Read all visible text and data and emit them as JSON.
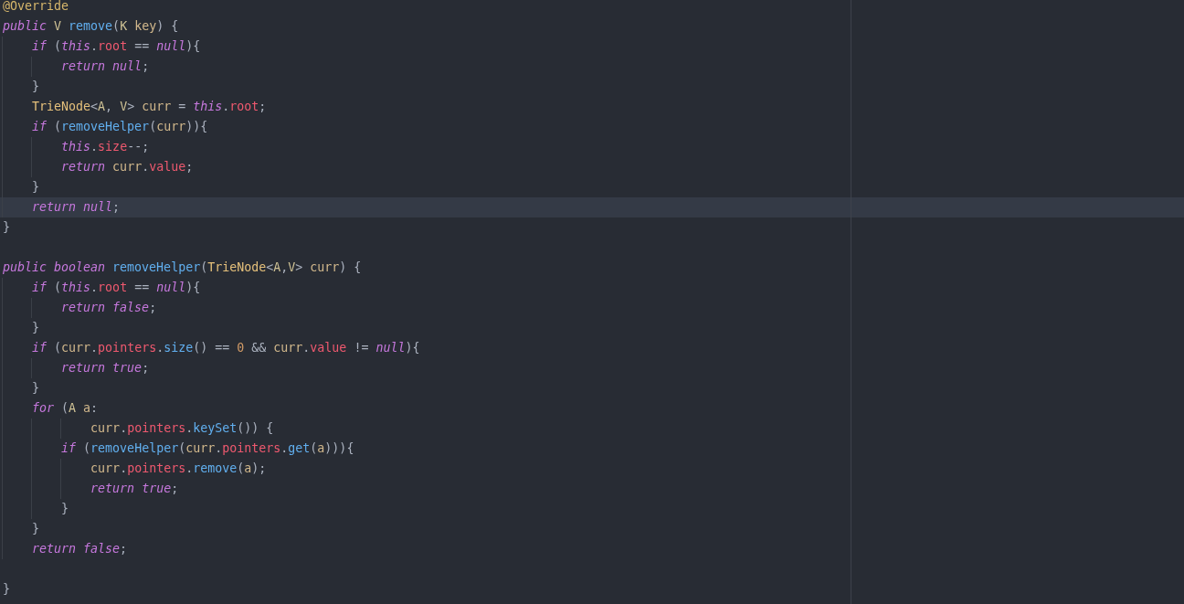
{
  "editor": {
    "lines": [
      {
        "current": false,
        "tokens": [
          {
            "kind": "ann",
            "text": "@Override"
          }
        ]
      },
      {
        "current": false,
        "tokens": [
          {
            "kind": "kw",
            "text": "public"
          },
          {
            "kind": "tparam",
            "text": " V"
          },
          {
            "kind": "fn",
            "text": " remove"
          },
          {
            "kind": "punct",
            "text": "("
          },
          {
            "kind": "tparam",
            "text": "K"
          },
          {
            "kind": "var",
            "text": " key"
          },
          {
            "kind": "punct",
            "text": ") {"
          }
        ]
      },
      {
        "current": false,
        "tokens": [
          {
            "kind": "kw",
            "text": "    if"
          },
          {
            "kind": "punct",
            "text": " ("
          },
          {
            "kind": "kw",
            "text": "this"
          },
          {
            "kind": "punct",
            "text": "."
          },
          {
            "kind": "field",
            "text": "root"
          },
          {
            "kind": "punct",
            "text": " == "
          },
          {
            "kind": "kw",
            "text": "null"
          },
          {
            "kind": "punct",
            "text": "){"
          }
        ]
      },
      {
        "current": false,
        "tokens": [
          {
            "kind": "kw",
            "text": "        return null"
          },
          {
            "kind": "punct",
            "text": ";"
          }
        ]
      },
      {
        "current": false,
        "tokens": [
          {
            "kind": "punct",
            "text": "    }"
          }
        ]
      },
      {
        "current": false,
        "tokens": [
          {
            "kind": "type",
            "text": "    TrieNode"
          },
          {
            "kind": "punct",
            "text": "<"
          },
          {
            "kind": "tparam",
            "text": "A"
          },
          {
            "kind": "punct",
            "text": ", "
          },
          {
            "kind": "tparam",
            "text": "V"
          },
          {
            "kind": "punct",
            "text": ">"
          },
          {
            "kind": "var",
            "text": " curr"
          },
          {
            "kind": "punct",
            "text": " = "
          },
          {
            "kind": "kw",
            "text": "this"
          },
          {
            "kind": "punct",
            "text": "."
          },
          {
            "kind": "field",
            "text": "root"
          },
          {
            "kind": "punct",
            "text": ";"
          }
        ]
      },
      {
        "current": false,
        "tokens": [
          {
            "kind": "kw",
            "text": "    if"
          },
          {
            "kind": "punct",
            "text": " ("
          },
          {
            "kind": "fn",
            "text": "removeHelper"
          },
          {
            "kind": "punct",
            "text": "("
          },
          {
            "kind": "var",
            "text": "curr"
          },
          {
            "kind": "punct",
            "text": ")){"
          }
        ]
      },
      {
        "current": false,
        "tokens": [
          {
            "kind": "kw",
            "text": "        this"
          },
          {
            "kind": "punct",
            "text": "."
          },
          {
            "kind": "field",
            "text": "size"
          },
          {
            "kind": "punct",
            "text": "--;"
          }
        ]
      },
      {
        "current": false,
        "tokens": [
          {
            "kind": "kw",
            "text": "        return"
          },
          {
            "kind": "var",
            "text": " curr"
          },
          {
            "kind": "punct",
            "text": "."
          },
          {
            "kind": "field",
            "text": "value"
          },
          {
            "kind": "punct",
            "text": ";"
          }
        ]
      },
      {
        "current": false,
        "tokens": [
          {
            "kind": "punct",
            "text": "    }"
          }
        ]
      },
      {
        "current": true,
        "tokens": [
          {
            "kind": "kw",
            "text": "    return null"
          },
          {
            "kind": "punct",
            "text": ";"
          }
        ]
      },
      {
        "current": false,
        "tokens": [
          {
            "kind": "punct",
            "text": "}"
          }
        ]
      },
      {
        "current": false
      },
      {
        "current": false,
        "tokens": [
          {
            "kind": "kw",
            "text": "public boolean"
          },
          {
            "kind": "fn",
            "text": " removeHelper"
          },
          {
            "kind": "punct",
            "text": "("
          },
          {
            "kind": "type",
            "text": "TrieNode"
          },
          {
            "kind": "punct",
            "text": "<"
          },
          {
            "kind": "tparam",
            "text": "A"
          },
          {
            "kind": "punct",
            "text": ","
          },
          {
            "kind": "tparam",
            "text": "V"
          },
          {
            "kind": "punct",
            "text": ">"
          },
          {
            "kind": "var",
            "text": " curr"
          },
          {
            "kind": "punct",
            "text": ") {"
          }
        ]
      },
      {
        "current": false,
        "tokens": [
          {
            "kind": "kw",
            "text": "    if"
          },
          {
            "kind": "punct",
            "text": " ("
          },
          {
            "kind": "kw",
            "text": "this"
          },
          {
            "kind": "punct",
            "text": "."
          },
          {
            "kind": "field",
            "text": "root"
          },
          {
            "kind": "punct",
            "text": " == "
          },
          {
            "kind": "kw",
            "text": "null"
          },
          {
            "kind": "punct",
            "text": "){"
          }
        ]
      },
      {
        "current": false,
        "tokens": [
          {
            "kind": "kw",
            "text": "        return false"
          },
          {
            "kind": "punct",
            "text": ";"
          }
        ]
      },
      {
        "current": false,
        "tokens": [
          {
            "kind": "punct",
            "text": "    }"
          }
        ]
      },
      {
        "current": false,
        "tokens": [
          {
            "kind": "kw",
            "text": "    if"
          },
          {
            "kind": "punct",
            "text": " ("
          },
          {
            "kind": "var",
            "text": "curr"
          },
          {
            "kind": "punct",
            "text": "."
          },
          {
            "kind": "field",
            "text": "pointers"
          },
          {
            "kind": "punct",
            "text": "."
          },
          {
            "kind": "fn",
            "text": "size"
          },
          {
            "kind": "punct",
            "text": "() == "
          },
          {
            "kind": "num",
            "text": "0"
          },
          {
            "kind": "punct",
            "text": " && "
          },
          {
            "kind": "var",
            "text": "curr"
          },
          {
            "kind": "punct",
            "text": "."
          },
          {
            "kind": "field",
            "text": "value"
          },
          {
            "kind": "punct",
            "text": " != "
          },
          {
            "kind": "kw",
            "text": "null"
          },
          {
            "kind": "punct",
            "text": "){"
          }
        ]
      },
      {
        "current": false,
        "tokens": [
          {
            "kind": "kw",
            "text": "        return true"
          },
          {
            "kind": "punct",
            "text": ";"
          }
        ]
      },
      {
        "current": false,
        "tokens": [
          {
            "kind": "punct",
            "text": "    }"
          }
        ]
      },
      {
        "current": false,
        "tokens": [
          {
            "kind": "kw",
            "text": "    for"
          },
          {
            "kind": "punct",
            "text": " ("
          },
          {
            "kind": "tparam",
            "text": "A"
          },
          {
            "kind": "var",
            "text": " a"
          },
          {
            "kind": "punct",
            "text": ":"
          }
        ]
      },
      {
        "current": false,
        "tokens": [
          {
            "kind": "var",
            "text": "            curr"
          },
          {
            "kind": "punct",
            "text": "."
          },
          {
            "kind": "field",
            "text": "pointers"
          },
          {
            "kind": "punct",
            "text": "."
          },
          {
            "kind": "fn",
            "text": "keySet"
          },
          {
            "kind": "punct",
            "text": "()) {"
          }
        ]
      },
      {
        "current": false,
        "tokens": [
          {
            "kind": "kw",
            "text": "        if"
          },
          {
            "kind": "punct",
            "text": " ("
          },
          {
            "kind": "fn",
            "text": "removeHelper"
          },
          {
            "kind": "punct",
            "text": "("
          },
          {
            "kind": "var",
            "text": "curr"
          },
          {
            "kind": "punct",
            "text": "."
          },
          {
            "kind": "field",
            "text": "pointers"
          },
          {
            "kind": "punct",
            "text": "."
          },
          {
            "kind": "fn",
            "text": "get"
          },
          {
            "kind": "punct",
            "text": "("
          },
          {
            "kind": "var",
            "text": "a"
          },
          {
            "kind": "punct",
            "text": "))){"
          }
        ]
      },
      {
        "current": false,
        "tokens": [
          {
            "kind": "var",
            "text": "            curr"
          },
          {
            "kind": "punct",
            "text": "."
          },
          {
            "kind": "field",
            "text": "pointers"
          },
          {
            "kind": "punct",
            "text": "."
          },
          {
            "kind": "fn",
            "text": "remove"
          },
          {
            "kind": "punct",
            "text": "("
          },
          {
            "kind": "var",
            "text": "a"
          },
          {
            "kind": "punct",
            "text": ");"
          }
        ]
      },
      {
        "current": false,
        "tokens": [
          {
            "kind": "kw",
            "text": "            return true"
          },
          {
            "kind": "punct",
            "text": ";"
          }
        ]
      },
      {
        "current": false,
        "tokens": [
          {
            "kind": "punct",
            "text": "        }"
          }
        ]
      },
      {
        "current": false,
        "tokens": [
          {
            "kind": "punct",
            "text": "    }"
          }
        ]
      },
      {
        "current": false,
        "tokens": [
          {
            "kind": "kw",
            "text": "    return false"
          },
          {
            "kind": "punct",
            "text": ";"
          }
        ]
      },
      {
        "current": false
      },
      {
        "current": false,
        "tokens": [
          {
            "kind": "punct",
            "text": "}"
          }
        ]
      }
    ]
  }
}
